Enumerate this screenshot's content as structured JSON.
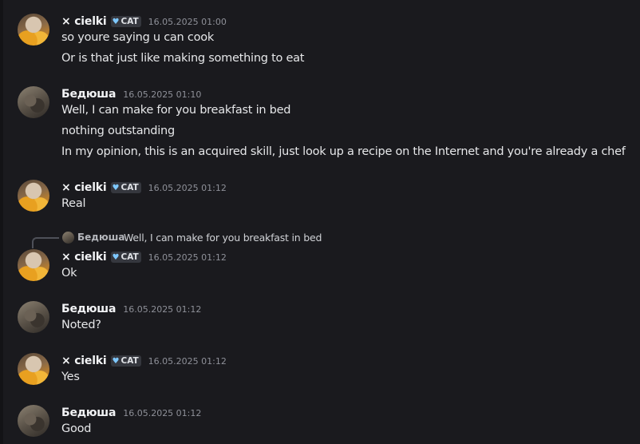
{
  "messages": [
    {
      "author": "× cielki",
      "tag": "CAT",
      "tag_icon": "heart-icon",
      "timestamp": "16.05.2025 01:00",
      "lines": [
        "so youre saying u can cook",
        "Or is that just like making something to eat"
      ]
    },
    {
      "author": "Бедюша",
      "timestamp": "16.05.2025 01:10",
      "lines": [
        "Well, I can make for you breakfast in bed",
        "nothing outstanding",
        "In my opinion, this is an acquired skill, just look up a recipe on the Internet and you're already a chef"
      ]
    },
    {
      "author": "× cielki",
      "tag": "CAT",
      "tag_icon": "heart-icon",
      "timestamp": "16.05.2025 01:12",
      "lines": [
        "Real"
      ]
    },
    {
      "reply": {
        "author": "Бедюша",
        "text": "Well, I can make for you breakfast in bed"
      },
      "author": "× cielki",
      "tag": "CAT",
      "tag_icon": "heart-icon",
      "timestamp": "16.05.2025 01:12",
      "lines": [
        "Ok"
      ]
    },
    {
      "author": "Бедюша",
      "timestamp": "16.05.2025 01:12",
      "lines": [
        "Noted?"
      ]
    },
    {
      "author": "× cielki",
      "tag": "CAT",
      "tag_icon": "heart-icon",
      "timestamp": "16.05.2025 01:12",
      "lines": [
        "Yes"
      ]
    },
    {
      "author": "Бедюша",
      "timestamp": "16.05.2025 01:12",
      "lines": [
        "Good"
      ]
    }
  ],
  "colors": {
    "background": "#1a1a1e",
    "text": "#e6e7e9",
    "timestamp": "#8e9098",
    "tag_heart": "#7ec8ff"
  }
}
